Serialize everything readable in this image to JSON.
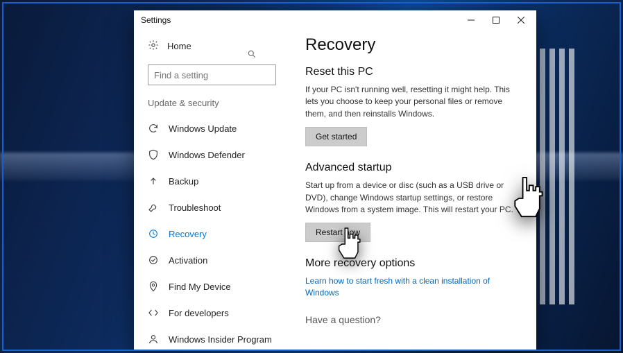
{
  "window": {
    "title": "Settings"
  },
  "sidebar": {
    "home": "Home",
    "search_placeholder": "Find a setting",
    "section": "Update & security",
    "items": [
      {
        "label": "Windows Update"
      },
      {
        "label": "Windows Defender"
      },
      {
        "label": "Backup"
      },
      {
        "label": "Troubleshoot"
      },
      {
        "label": "Recovery"
      },
      {
        "label": "Activation"
      },
      {
        "label": "Find My Device"
      },
      {
        "label": "For developers"
      },
      {
        "label": "Windows Insider Program"
      }
    ]
  },
  "content": {
    "heading": "Recovery",
    "reset": {
      "title": "Reset this PC",
      "desc": "If your PC isn't running well, resetting it might help. This lets you choose to keep your personal files or remove them, and then reinstalls Windows.",
      "button": "Get started"
    },
    "advanced": {
      "title": "Advanced startup",
      "desc": "Start up from a device or disc (such as a USB drive or DVD), change Windows startup settings, or restore Windows from a system image. This will restart your PC.",
      "button": "Restart now"
    },
    "more": {
      "title": "More recovery options",
      "link": "Learn how to start fresh with a clean installation of Windows"
    },
    "question": "Have a question?"
  }
}
